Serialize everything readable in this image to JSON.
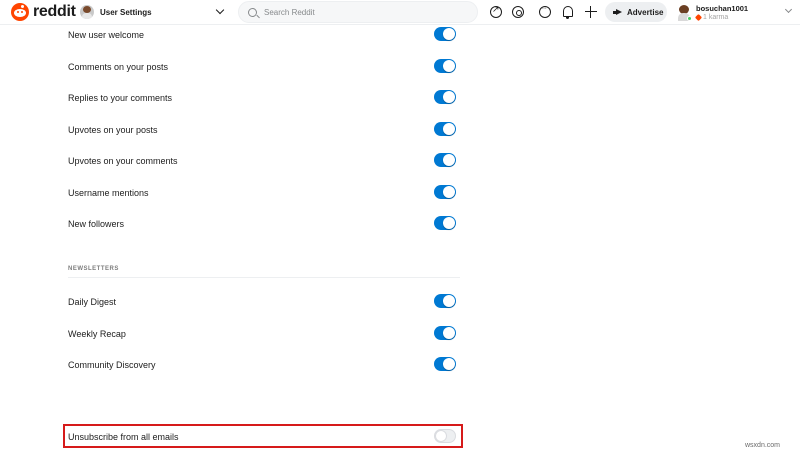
{
  "header": {
    "logo_text": "reddit",
    "community_label": "User Settings",
    "search_placeholder": "Search Reddit",
    "advertise_label": "Advertise",
    "username": "bosuchan1001",
    "karma": "1 karma"
  },
  "settings": {
    "toggles": [
      {
        "label": "New user welcome",
        "on": true
      },
      {
        "label": "Comments on your posts",
        "on": true
      },
      {
        "label": "Replies to your comments",
        "on": true
      },
      {
        "label": "Upvotes on your posts",
        "on": true
      },
      {
        "label": "Upvotes on your comments",
        "on": true
      },
      {
        "label": "Username mentions",
        "on": true
      },
      {
        "label": "New followers",
        "on": true
      }
    ],
    "newsletters_heading": "NEWSLETTERS",
    "newsletters": [
      {
        "label": "Daily Digest",
        "on": true
      },
      {
        "label": "Weekly Recap",
        "on": true
      },
      {
        "label": "Community Discovery",
        "on": true
      }
    ],
    "unsubscribe": {
      "label": "Unsubscribe from all emails",
      "on": false
    }
  },
  "colors": {
    "accent": "#0079d3",
    "brand": "#ff4500",
    "highlight_border": "#d61a1a"
  },
  "watermark": "wsxdn.com"
}
